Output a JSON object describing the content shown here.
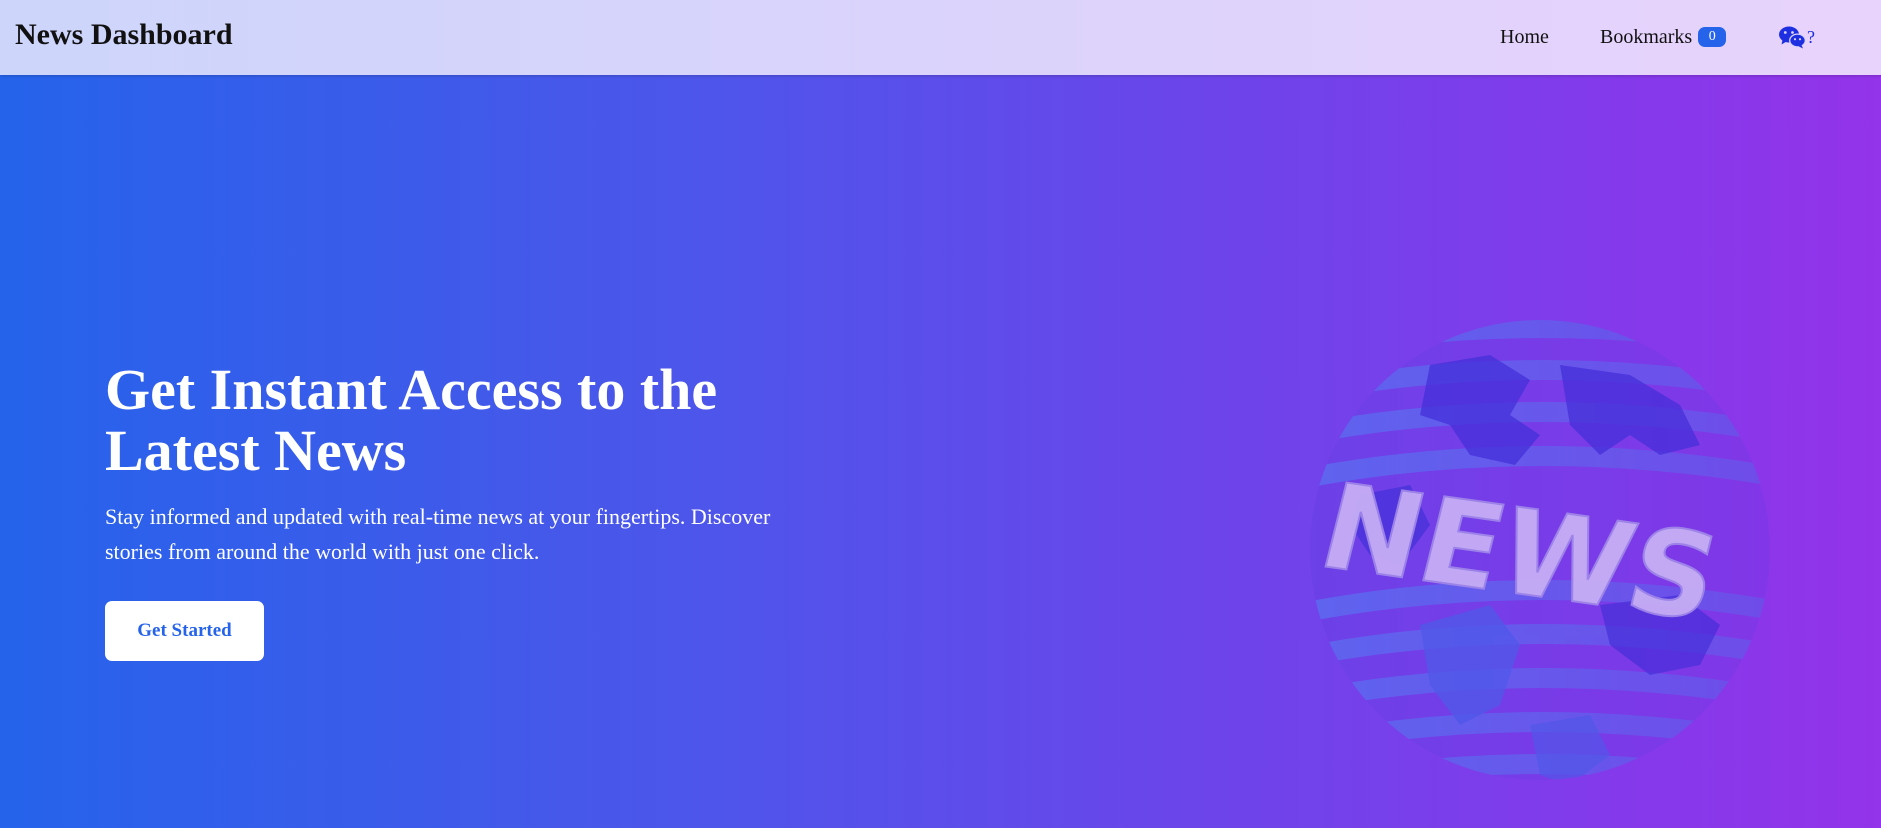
{
  "app": {
    "brand": "News Dashboard"
  },
  "nav": {
    "home_label": "Home",
    "bookmarks_label": "Bookmarks",
    "bookmarks_count": "0",
    "chat_icon": "wechat-icon",
    "chat_suffix": "?"
  },
  "hero": {
    "title": "Get Instant Access to the Latest News",
    "subtitle": "Stay informed and updated with real-time news at your fingertips. Discover stories from around the world with just one click.",
    "cta_label": "Get Started",
    "illustration_icon": "news-globe-icon",
    "illustration_text": "NEWS"
  },
  "colors": {
    "accent": "#2563eb",
    "gradient_start": "#2563eb",
    "gradient_end": "#9333ea",
    "badge": "#2563eb",
    "chat_icon": "#1d2fe0",
    "cta_text": "#2563eb"
  }
}
